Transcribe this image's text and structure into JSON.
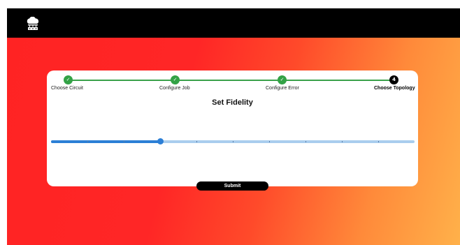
{
  "header": {
    "logo_icon": "cloud-network-icon"
  },
  "colors": {
    "topbar": "#000000",
    "step_done": "#33a246",
    "step_active": "#000000",
    "slider_fill": "#2c7fd6",
    "slider_track": "#a9cdee",
    "gradient_start": "#ff2323",
    "gradient_end": "#ffb14a"
  },
  "stepper": {
    "steps": [
      {
        "label": "Choose Circuit",
        "status": "done",
        "marker": "✓"
      },
      {
        "label": "Configure Job",
        "status": "done",
        "marker": "✓"
      },
      {
        "label": "Configure Error",
        "status": "done",
        "marker": "✓"
      },
      {
        "label": "Choose Topology",
        "status": "active",
        "marker": "4"
      }
    ]
  },
  "form": {
    "title": "Set Fidelity",
    "slider": {
      "level": 0.3,
      "tick_count": 10
    },
    "submit_label": "Submit"
  }
}
